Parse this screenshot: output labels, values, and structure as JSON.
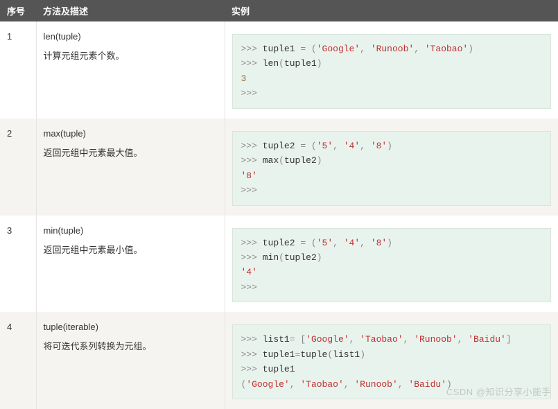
{
  "headers": {
    "num": "序号",
    "desc": "方法及描述",
    "example": "实例"
  },
  "rows": [
    {
      "num": "1",
      "method": "len(tuple)",
      "desc": "计算元组元素个数。",
      "code": [
        {
          "type": "in",
          "tokens": [
            {
              "c": "kw",
              "t": "tuple1 "
            },
            {
              "c": "op",
              "t": "= ("
            },
            {
              "c": "str",
              "t": "'Google'"
            },
            {
              "c": "op",
              "t": ", "
            },
            {
              "c": "str",
              "t": "'Runoob'"
            },
            {
              "c": "op",
              "t": ", "
            },
            {
              "c": "str",
              "t": "'Taobao'"
            },
            {
              "c": "op",
              "t": ")"
            }
          ]
        },
        {
          "type": "in",
          "tokens": [
            {
              "c": "kw",
              "t": "len"
            },
            {
              "c": "op",
              "t": "("
            },
            {
              "c": "kw",
              "t": "tuple1"
            },
            {
              "c": "op",
              "t": ")"
            }
          ]
        },
        {
          "type": "out",
          "tokens": [
            {
              "c": "res",
              "t": "3"
            }
          ]
        },
        {
          "type": "in",
          "tokens": []
        }
      ]
    },
    {
      "num": "2",
      "method": "max(tuple)",
      "desc": "返回元组中元素最大值。",
      "code": [
        {
          "type": "in",
          "tokens": [
            {
              "c": "kw",
              "t": "tuple2 "
            },
            {
              "c": "op",
              "t": "= ("
            },
            {
              "c": "str",
              "t": "'5'"
            },
            {
              "c": "op",
              "t": ", "
            },
            {
              "c": "str",
              "t": "'4'"
            },
            {
              "c": "op",
              "t": ", "
            },
            {
              "c": "str",
              "t": "'8'"
            },
            {
              "c": "op",
              "t": ")"
            }
          ]
        },
        {
          "type": "in",
          "tokens": [
            {
              "c": "kw",
              "t": "max"
            },
            {
              "c": "op",
              "t": "("
            },
            {
              "c": "kw",
              "t": "tuple2"
            },
            {
              "c": "op",
              "t": ")"
            }
          ]
        },
        {
          "type": "out",
          "tokens": [
            {
              "c": "str",
              "t": "'8'"
            }
          ]
        },
        {
          "type": "in",
          "tokens": []
        }
      ]
    },
    {
      "num": "3",
      "method": "min(tuple)",
      "desc": "返回元组中元素最小值。",
      "code": [
        {
          "type": "in",
          "tokens": [
            {
              "c": "kw",
              "t": "tuple2 "
            },
            {
              "c": "op",
              "t": "= ("
            },
            {
              "c": "str",
              "t": "'5'"
            },
            {
              "c": "op",
              "t": ", "
            },
            {
              "c": "str",
              "t": "'4'"
            },
            {
              "c": "op",
              "t": ", "
            },
            {
              "c": "str",
              "t": "'8'"
            },
            {
              "c": "op",
              "t": ")"
            }
          ]
        },
        {
          "type": "in",
          "tokens": [
            {
              "c": "kw",
              "t": "min"
            },
            {
              "c": "op",
              "t": "("
            },
            {
              "c": "kw",
              "t": "tuple2"
            },
            {
              "c": "op",
              "t": ")"
            }
          ]
        },
        {
          "type": "out",
          "tokens": [
            {
              "c": "str",
              "t": "'4'"
            }
          ]
        },
        {
          "type": "in",
          "tokens": []
        }
      ]
    },
    {
      "num": "4",
      "method": "tuple(iterable)",
      "desc": "将可迭代系列转换为元组。",
      "code": [
        {
          "type": "in",
          "tokens": [
            {
              "c": "kw",
              "t": "list1"
            },
            {
              "c": "op",
              "t": "= ["
            },
            {
              "c": "str",
              "t": "'Google'"
            },
            {
              "c": "op",
              "t": ", "
            },
            {
              "c": "str",
              "t": "'Taobao'"
            },
            {
              "c": "op",
              "t": ", "
            },
            {
              "c": "str",
              "t": "'Runoob'"
            },
            {
              "c": "op",
              "t": ", "
            },
            {
              "c": "str",
              "t": "'Baidu'"
            },
            {
              "c": "op",
              "t": "]"
            }
          ]
        },
        {
          "type": "in",
          "tokens": [
            {
              "c": "kw",
              "t": "tuple1"
            },
            {
              "c": "op",
              "t": "="
            },
            {
              "c": "kw",
              "t": "tuple"
            },
            {
              "c": "op",
              "t": "("
            },
            {
              "c": "kw",
              "t": "list1"
            },
            {
              "c": "op",
              "t": ")"
            }
          ]
        },
        {
          "type": "in",
          "tokens": [
            {
              "c": "kw",
              "t": "tuple1"
            }
          ]
        },
        {
          "type": "out",
          "tokens": [
            {
              "c": "op",
              "t": "("
            },
            {
              "c": "str",
              "t": "'Google'"
            },
            {
              "c": "op",
              "t": ", "
            },
            {
              "c": "str",
              "t": "'Taobao'"
            },
            {
              "c": "op",
              "t": ", "
            },
            {
              "c": "str",
              "t": "'Runoob'"
            },
            {
              "c": "op",
              "t": ", "
            },
            {
              "c": "str",
              "t": "'Baidu'"
            },
            {
              "c": "op",
              "t": ")"
            }
          ]
        }
      ]
    }
  ],
  "prompt": ">>> ",
  "watermark": "CSDN @知识分享小能手"
}
